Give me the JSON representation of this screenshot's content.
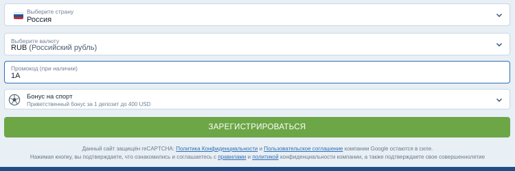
{
  "country": {
    "label": "Выберите страну",
    "value": "Россия",
    "flag_colors": [
      "#ffffff",
      "#1c57a5",
      "#d52b1e"
    ]
  },
  "currency": {
    "label": "Выберите валюту",
    "code": "RUB",
    "name": "(Российский рубль)"
  },
  "promo": {
    "label": "Промокод (при наличии)",
    "value": "1A"
  },
  "bonus": {
    "title": "Бонус на спорт",
    "description": "Приветственный бонус за 1 депозит до 400 USD"
  },
  "register_button": {
    "label": "ЗАРЕГИСТРИРОВАТЬСЯ",
    "color": "#6ca646"
  },
  "notice": {
    "line1_prefix": "Данный сайт защищён reCAPTCHA:",
    "privacy_link": "Политика Конфиденциальности",
    "and": "и",
    "terms_link": "Пользовательское соглашение",
    "line1_suffix": "компании Google остаются в силе.",
    "line2_prefix": "Нажимая кнопку, вы подтверждаете, что ознакомились и соглашаетесь с",
    "rules_link": "правилами",
    "and2": "и",
    "policy_link": "политикой",
    "line2_suffix": "конфиденциальности компании, а также подтверждаете свое совершеннолетие"
  },
  "colors": {
    "accent_blue": "#2d6db5",
    "background": "#e8eff5",
    "footer": "#1e4e86"
  },
  "icons": {
    "country": "russia-flag-icon",
    "bonus": "soccer-ball-icon",
    "dropdown": "chevron-down-icon"
  }
}
